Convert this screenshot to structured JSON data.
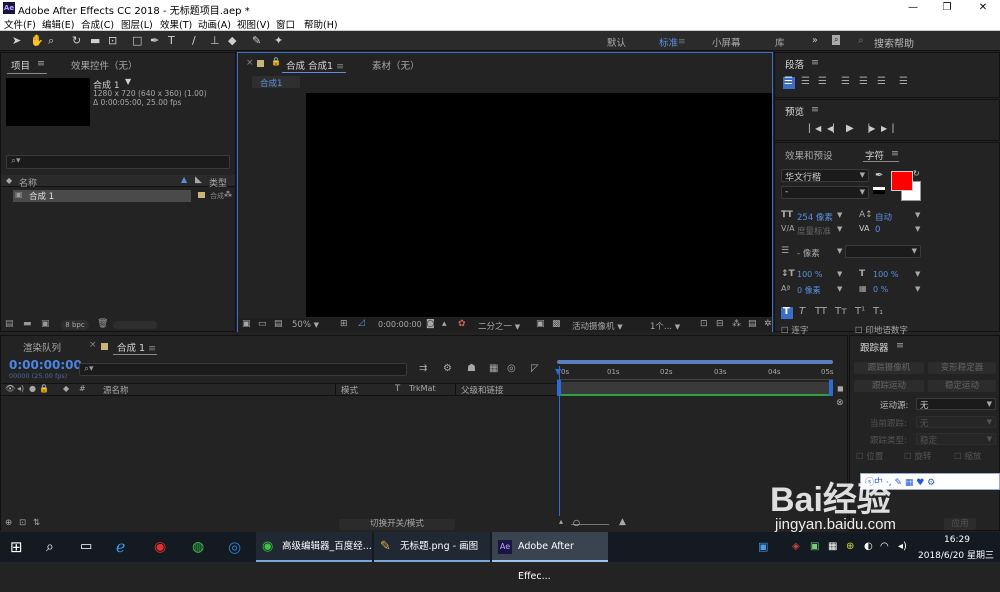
{
  "window": {
    "title": "Adobe After Effects CC 2018 - 无标题项目.aep *",
    "logo": "Ae",
    "minimize": "—",
    "maximize": "❐",
    "close": "✕"
  },
  "menu": [
    "文件(F)",
    "编辑(E)",
    "合成(C)",
    "图层(L)",
    "效果(T)",
    "动画(A)",
    "视图(V)",
    "窗口",
    "帮助(H)"
  ],
  "workspaces": [
    "默认",
    "标准",
    "小屏幕",
    "库"
  ],
  "search": {
    "placeholder": "搜索帮助"
  },
  "project": {
    "tab": "项目",
    "effects_tab": "效果控件（无）",
    "comp_name": "合成 1",
    "comp_info1": "1280 x 720  (640 x 360) (1.00)",
    "comp_info2": "Δ 0:00:05:00, 25.00 fps",
    "col_name": "名称",
    "col_type": "类型",
    "item_name": "合成 1",
    "item_type": "合成",
    "bpc": "8 bpc"
  },
  "viewer": {
    "tab": "合成 合成1",
    "footage_tab": "素材（无）",
    "sub_tab": "合成1",
    "zoom": "50%",
    "time": "0:00:00:00",
    "resolution": "二分之一",
    "camera": "活动摄像机",
    "views": "1个..."
  },
  "paragraph": {
    "tab": "段落"
  },
  "preview": {
    "tab": "预览"
  },
  "effects_presets": {
    "tab": "效果和预设"
  },
  "character": {
    "tab": "字符",
    "font": "华文行楷",
    "style": "-",
    "size": "254 像素",
    "leading": "自动",
    "kerning": "度量标准",
    "tracking": "0",
    "stroke": "- 像素",
    "vscale": "100 %",
    "hscale": "100 %",
    "baseline": "0 像素",
    "tsume": "0 %",
    "styles": [
      "T",
      "T",
      "TT",
      "Tт",
      "T¹",
      "T₁"
    ],
    "ligature": "连字",
    "hindi": "印地语数字",
    "fill_color": "#ff0000"
  },
  "timeline": {
    "render_tab": "渲染队列",
    "comp_tab": "合成 1",
    "timecode": "0:00:00:00",
    "frames": "00000 (25.00 fps)",
    "col_name": "源名称",
    "col_mode": "模式",
    "col_t": "T",
    "col_trkmat": "TrkMat",
    "col_parent": "父级和链接",
    "ticks": [
      "0s",
      "01s",
      "02s",
      "03s",
      "04s",
      "05s"
    ],
    "toggle": "切换开关/模式"
  },
  "tracker": {
    "tab": "跟踪器",
    "track_camera": "跟踪摄像机",
    "warp": "变形稳定器",
    "track_motion": "跟踪运动",
    "stabilize": "稳定运动",
    "motion_source": "运动源:",
    "motion_source_val": "无",
    "current_track": "当前跟踪:",
    "current_track_val": "无",
    "track_type": "跟踪类型:",
    "track_type_val": "稳定",
    "position": "位置",
    "rotation": "旋转",
    "scale": "缩放",
    "apply": "应用"
  },
  "watermark": {
    "brand": "Bai经验",
    "url": "jingyan.baidu.com"
  },
  "taskbar": {
    "apps": [
      "高级编辑器_百度经...",
      "无标题.png - 画图",
      "Adobe After Effec..."
    ],
    "time": "16:29",
    "date": "2018/6/20 星期三"
  }
}
